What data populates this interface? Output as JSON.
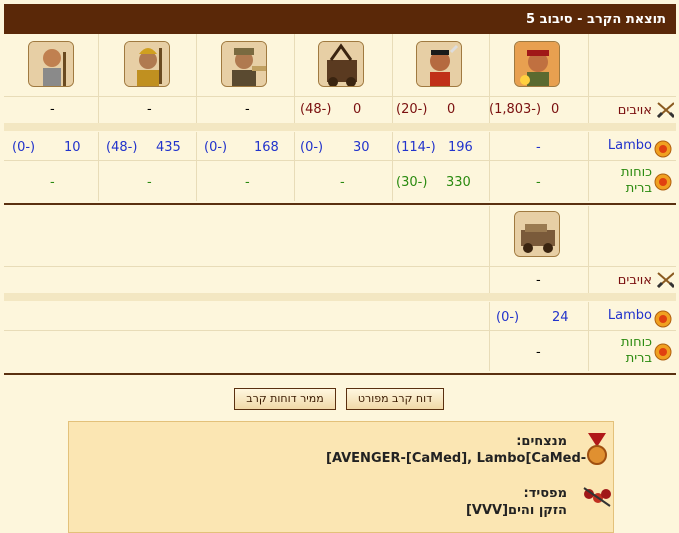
{
  "title": "תוצאת הקרב - סיבוב 5",
  "round1": {
    "units": [
      "unit-1",
      "unit-2",
      "unit-3",
      "unit-4",
      "unit-5",
      "unit-6"
    ],
    "enemies_label": "אויבים",
    "enemies": [
      {
        "count": "0",
        "loss": "(-1,803)"
      },
      {
        "count": "0",
        "loss": "(-20)"
      },
      {
        "count": "0",
        "loss": "(-48)"
      },
      {
        "dash": "-"
      },
      {
        "dash": "-"
      },
      {
        "dash": "-"
      }
    ],
    "player_label": "Lambo",
    "player_first_dash": "-",
    "player": [
      {
        "count": "196",
        "loss": "(-114)"
      },
      {
        "count": "30",
        "loss": "(-0)"
      },
      {
        "count": "168",
        "loss": "(-0)"
      },
      {
        "count": "435",
        "loss": "(-48)"
      },
      {
        "count": "10",
        "loss": "(-0)"
      }
    ],
    "allies_label_1": "כוחות",
    "allies_label_2": "ברית",
    "allies_first_dash": "-",
    "allies_count": "330",
    "allies_loss": "(-30)",
    "allies_dashes": [
      "-",
      "-",
      "-",
      "-"
    ]
  },
  "round2": {
    "enemies_label": "אויבים",
    "enemies_dash": "-",
    "player_label": "Lambo",
    "player_count": "24",
    "player_loss": "(-0)",
    "allies_label_1": "כוחות",
    "allies_label_2": "ברית",
    "allies_dash": "-"
  },
  "buttons": {
    "detailed": "דוח קרב מפורט",
    "converter": "ממיר דוחות קרב"
  },
  "summary": {
    "winners_label": "מנצחים:",
    "winners_value": "[AVENGER-[CaMed], Lambo[CaMed-",
    "loser_label": "מפסיד:",
    "loser_value": "הזקן והים[VVV]"
  },
  "colors": {
    "header": "#5a2808",
    "enemy": "#7a1010",
    "player": "#2233cc",
    "ally": "#2a8a10"
  }
}
